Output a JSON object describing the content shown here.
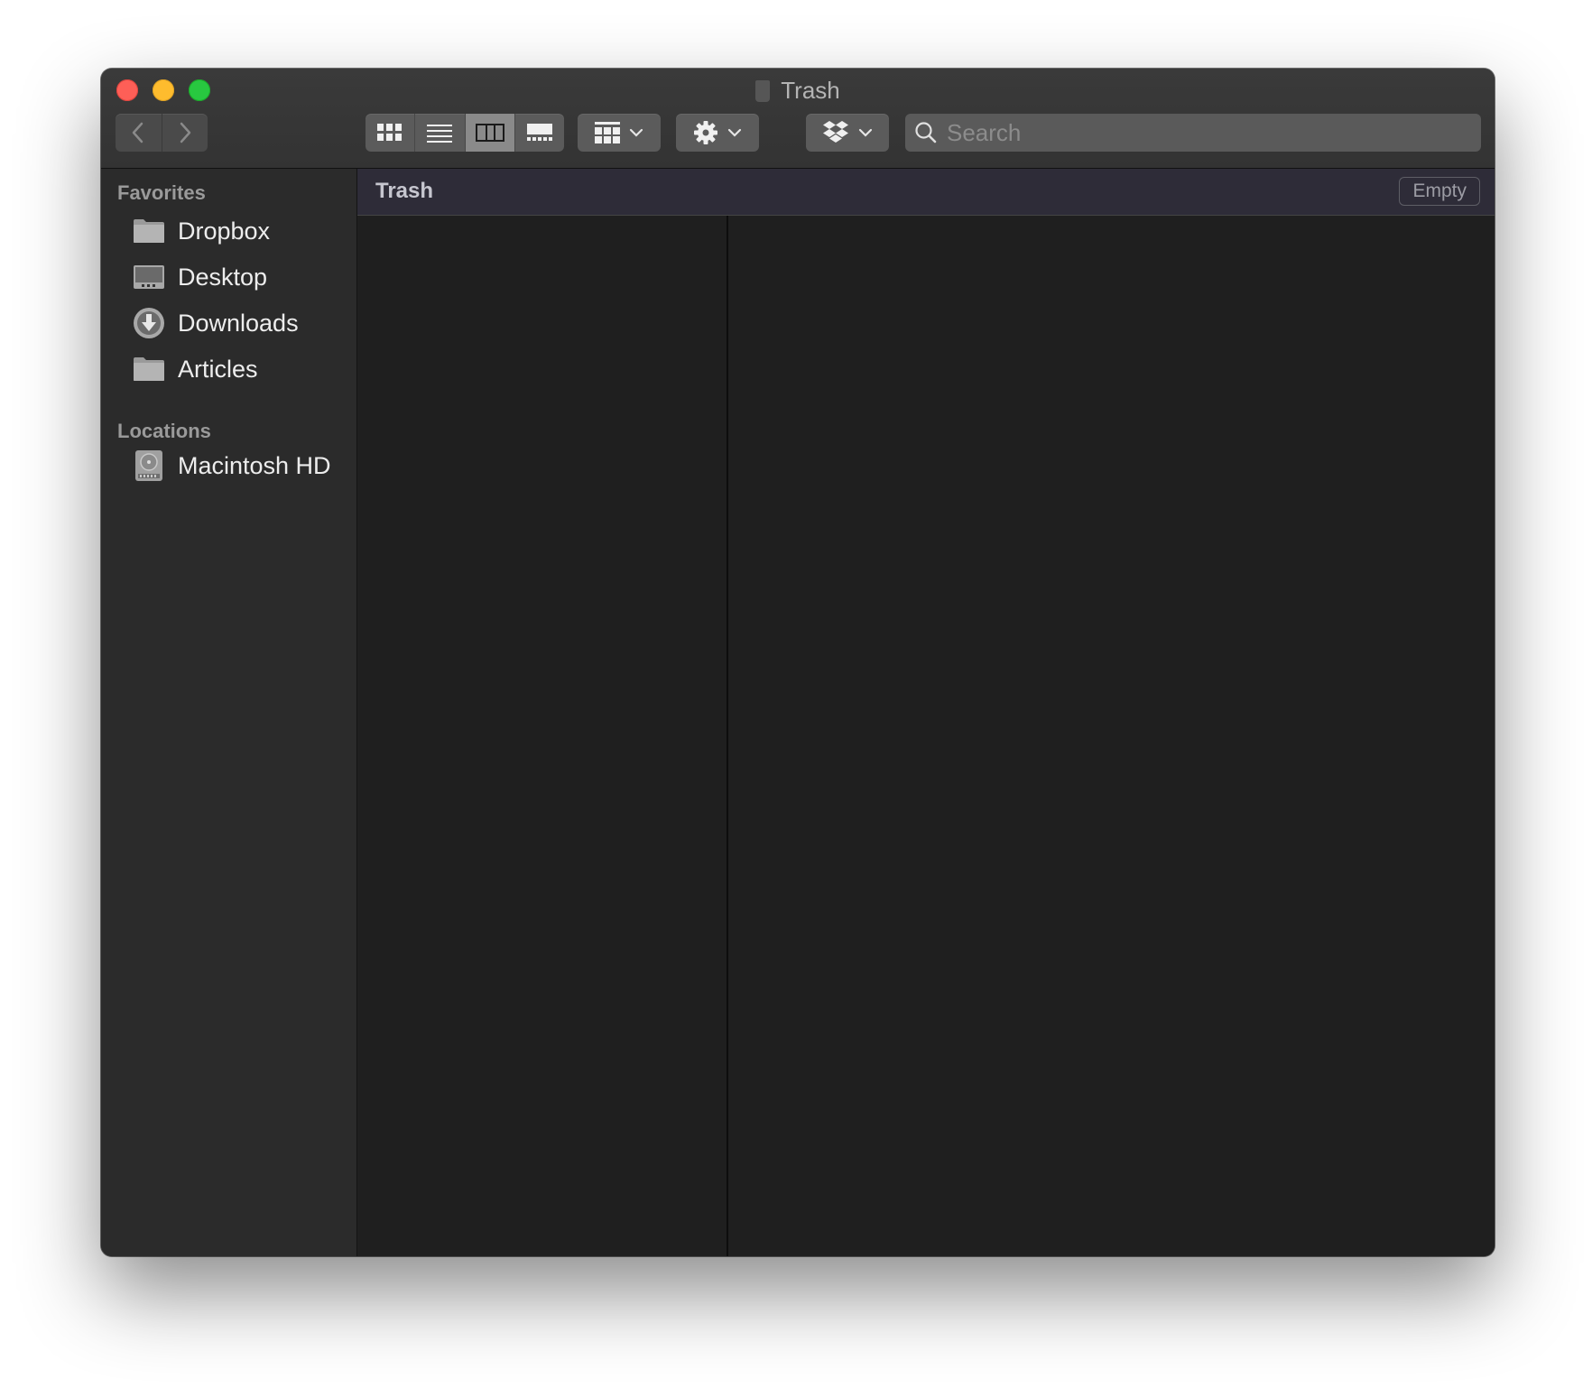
{
  "window": {
    "title": "Trash"
  },
  "toolbar": {
    "back_icon": "chevron-left-icon",
    "forward_icon": "chevron-right-icon",
    "view_modes": [
      "icon-view",
      "list-view",
      "column-view",
      "gallery-view"
    ],
    "active_view": "column-view",
    "arrange_icon": "grid-arrange-icon",
    "action_icon": "gear-icon",
    "dropbox_icon": "dropbox-icon"
  },
  "search": {
    "placeholder": "Search",
    "value": ""
  },
  "sidebar": {
    "favorites_header": "Favorites",
    "favorites": [
      {
        "label": "Dropbox",
        "icon": "folder-icon"
      },
      {
        "label": "Desktop",
        "icon": "desktop-folder-icon"
      },
      {
        "label": "Downloads",
        "icon": "downloads-icon"
      },
      {
        "label": "Articles",
        "icon": "folder-icon"
      }
    ],
    "locations_header": "Locations",
    "locations": [
      {
        "label": "Macintosh HD",
        "icon": "hard-drive-icon"
      }
    ]
  },
  "content": {
    "path_title": "Trash",
    "empty_button": "Empty"
  },
  "colors": {
    "close": "#fe5f57",
    "minimize": "#febc2e",
    "zoom": "#28c840",
    "window_bg": "#1f1f1f",
    "sidebar_bg": "#2b2b2b"
  }
}
